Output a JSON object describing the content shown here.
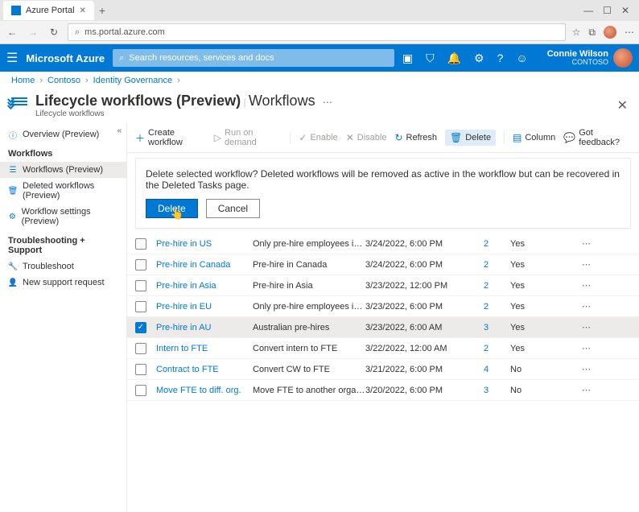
{
  "browser": {
    "tab_title": "Azure Portal",
    "url": "ms.portal.azure.com"
  },
  "topbar": {
    "brand": "Microsoft Azure",
    "search_placeholder": "Search resources, services and docs",
    "user_name": "Connie Wilson",
    "tenant": "CONTOSO"
  },
  "breadcrumb": [
    "Home",
    "Contoso",
    "Identity Governance"
  ],
  "title": {
    "main": "Lifecycle workflows (Preview)",
    "sub": "Lifecycle workflows",
    "section": "Workflows"
  },
  "sidebar": {
    "overview": "Overview (Preview)",
    "h1": "Workflows",
    "items1": [
      "Workflows (Preview)",
      "Deleted workflows (Preview)",
      "Workflow settings (Preview)"
    ],
    "h2": "Troubleshooting + Support",
    "items2": [
      "Troubleshoot",
      "New support request"
    ]
  },
  "toolbar": {
    "create": "Create workflow",
    "run": "Run on demand",
    "enable": "Enable",
    "disable": "Disable",
    "refresh": "Refresh",
    "del": "Delete",
    "column": "Column",
    "feedback": "Got feedback?"
  },
  "confirm": {
    "msg": "Delete selected workflow? Deleted workflows will be removed as active in the workflow but can be recovered in the Deleted Tasks page.",
    "ok": "Delete",
    "cancel": "Cancel"
  },
  "rows": [
    {
      "name": "Pre-hire in US",
      "desc": "Only pre-hire employees in the USA",
      "ts": "3/24/2022, 6:00 PM",
      "cnt": "2",
      "en": "Yes",
      "sel": false
    },
    {
      "name": "Pre-hire in Canada",
      "desc": "Pre-hire in Canada",
      "ts": "3/24/2022, 6:00 PM",
      "cnt": "2",
      "en": "Yes",
      "sel": false
    },
    {
      "name": "Pre-hire in Asia",
      "desc": "Pre-hire in Asia",
      "ts": "3/23/2022, 12:00 PM",
      "cnt": "2",
      "en": "Yes",
      "sel": false
    },
    {
      "name": "Pre-hire in EU",
      "desc": "Only pre-hire employees in Europe...",
      "ts": "3/23/2022, 6:00 PM",
      "cnt": "2",
      "en": "Yes",
      "sel": false
    },
    {
      "name": "Pre-hire in AU",
      "desc": "Australian pre-hires",
      "ts": "3/23/2022, 6:00 AM",
      "cnt": "3",
      "en": "Yes",
      "sel": true
    },
    {
      "name": "Intern to FTE",
      "desc": "Convert intern to FTE",
      "ts": "3/22/2022, 12:00 AM",
      "cnt": "2",
      "en": "Yes",
      "sel": false
    },
    {
      "name": "Contract to FTE",
      "desc": "Convert CW to FTE",
      "ts": "3/21/2022, 6:00 PM",
      "cnt": "4",
      "en": "No",
      "sel": false
    },
    {
      "name": "Move FTE to diff. org.",
      "desc": "Move FTE to another organization",
      "ts": "3/20/2022, 6:00 PM",
      "cnt": "3",
      "en": "No",
      "sel": false
    }
  ]
}
